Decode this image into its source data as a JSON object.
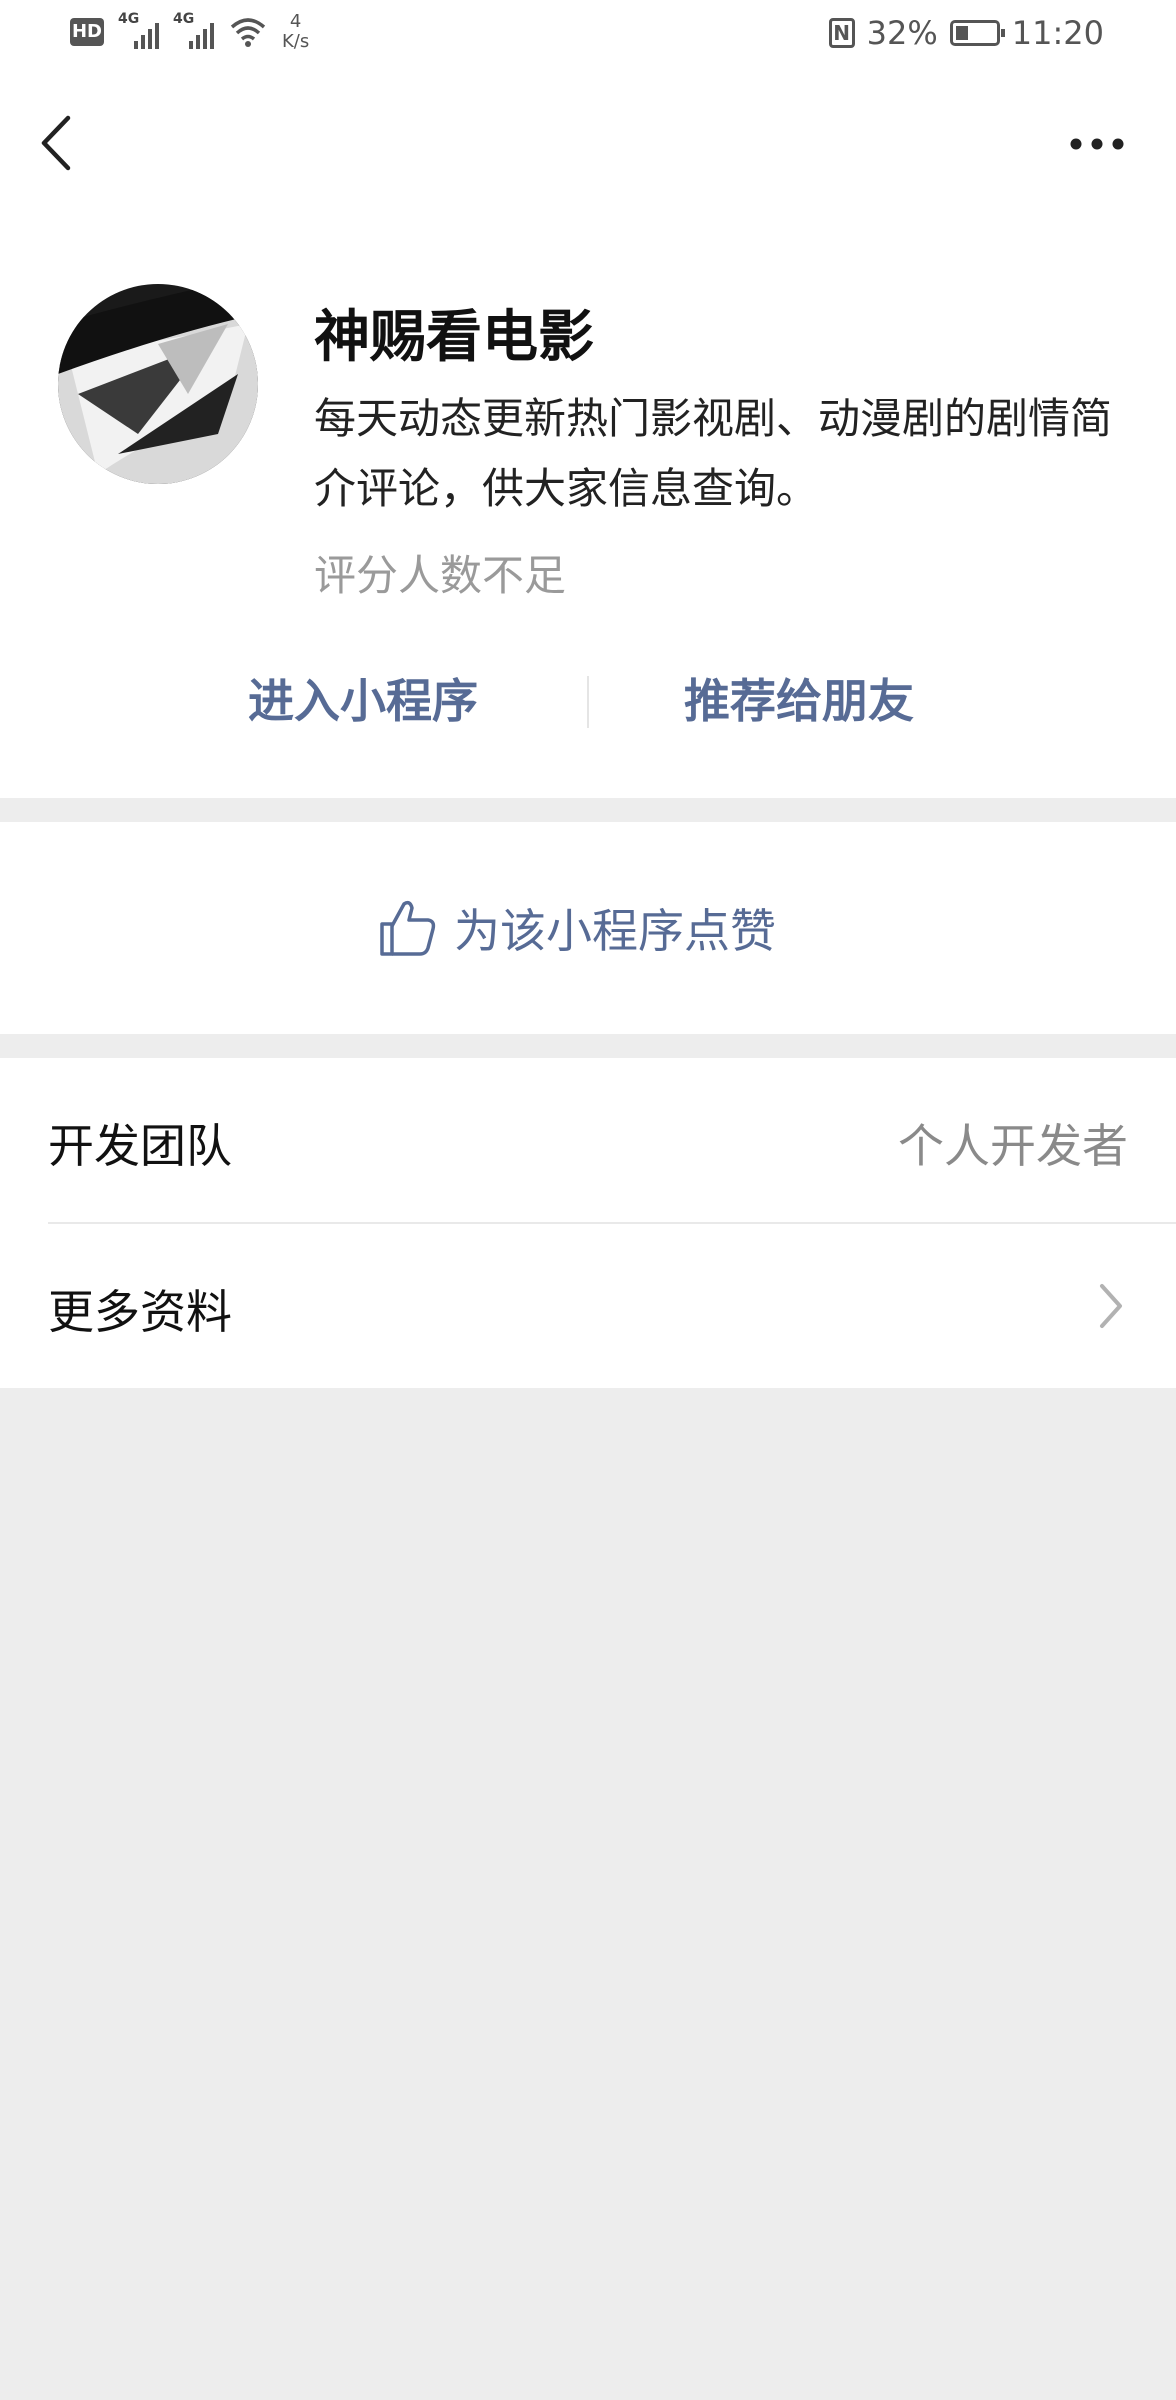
{
  "status_bar": {
    "hd_label": "HD",
    "sim1_label": "4G",
    "sim2_label": "4G",
    "net_speed_value": "4",
    "net_speed_unit": "K/s",
    "nfc_label": "N",
    "battery": "32%",
    "time": "11:20"
  },
  "nav": {
    "back_icon": "chevron-left-icon",
    "more_icon": "more-horizontal-icon"
  },
  "profile": {
    "name": "神赐看电影",
    "description": "每天动态更新热门影视剧、动漫剧的剧情简介评论，供大家信息查询。",
    "rating_text": "评分人数不足",
    "actions": {
      "enter_label": "进入小程序",
      "recommend_label": "推荐给朋友"
    }
  },
  "like": {
    "icon": "thumbs-up-icon",
    "label": "为该小程序点赞"
  },
  "info": {
    "team_label": "开发团队",
    "team_value": "个人开发者",
    "more_label": "更多资料"
  },
  "colors": {
    "link": "#576b95",
    "background": "#ededed",
    "card": "#ffffff",
    "muted": "#9a9a9a"
  }
}
